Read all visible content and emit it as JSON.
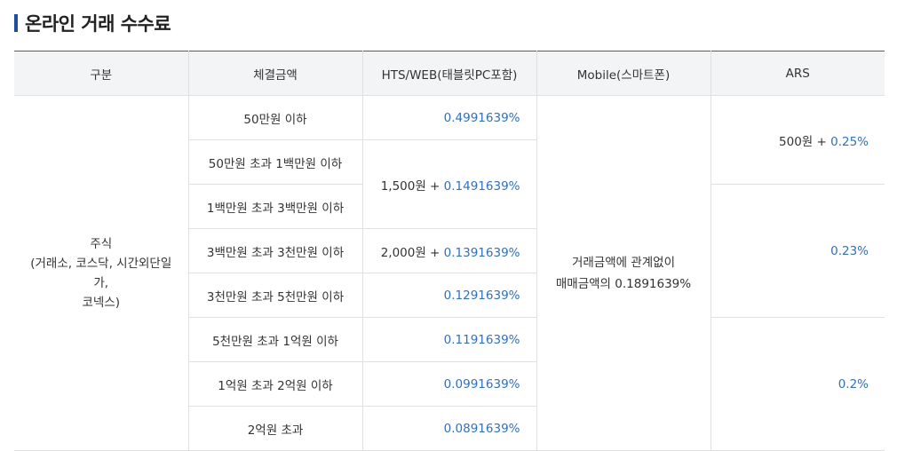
{
  "title": "온라인 거래 수수료",
  "headers": [
    "구분",
    "체결금액",
    "HTS/WEB(태블릿PC포함)",
    "Mobile(스마트폰)",
    "ARS"
  ],
  "category": {
    "line1": "주식",
    "line2": "(거래소, 코스닥, 시간외단일가,",
    "line3": "코넥스)"
  },
  "ranges": [
    "50만원 이하",
    "50만원 초과 1백만원 이하",
    "1백만원 초과 3백만원 이하",
    "3백만원 초과 3천만원 이하",
    "3천만원 초과 5천만원 이하",
    "5천만원 초과 1억원 이하",
    "1억원 초과 2억원 이하",
    "2억원 초과"
  ],
  "hts": {
    "r1": {
      "rate": "0.4991639%"
    },
    "r2": {
      "base": "1,500원 + ",
      "rate": "0.1491639%"
    },
    "r3": {
      "base": "2,000원 + ",
      "rate": "0.1391639%"
    },
    "r4": {
      "rate": "0.1291639%"
    },
    "r5": {
      "rate": "0.1191639%"
    },
    "r6": {
      "rate": "0.0991639%"
    },
    "r7": {
      "rate": "0.0891639%"
    }
  },
  "mobile": {
    "line1": "거래금액에 관계없이",
    "line2": "매매금액의 0.1891639%"
  },
  "ars": {
    "a1": {
      "base": "500원 + ",
      "rate": "0.25%"
    },
    "a2": {
      "rate": "0.23%"
    },
    "a3": {
      "rate": "0.2%"
    }
  },
  "colors": {
    "accent": "#1f4e9c",
    "rate_text": "#2f6fc6",
    "header_bg": "#f3f4f6"
  }
}
